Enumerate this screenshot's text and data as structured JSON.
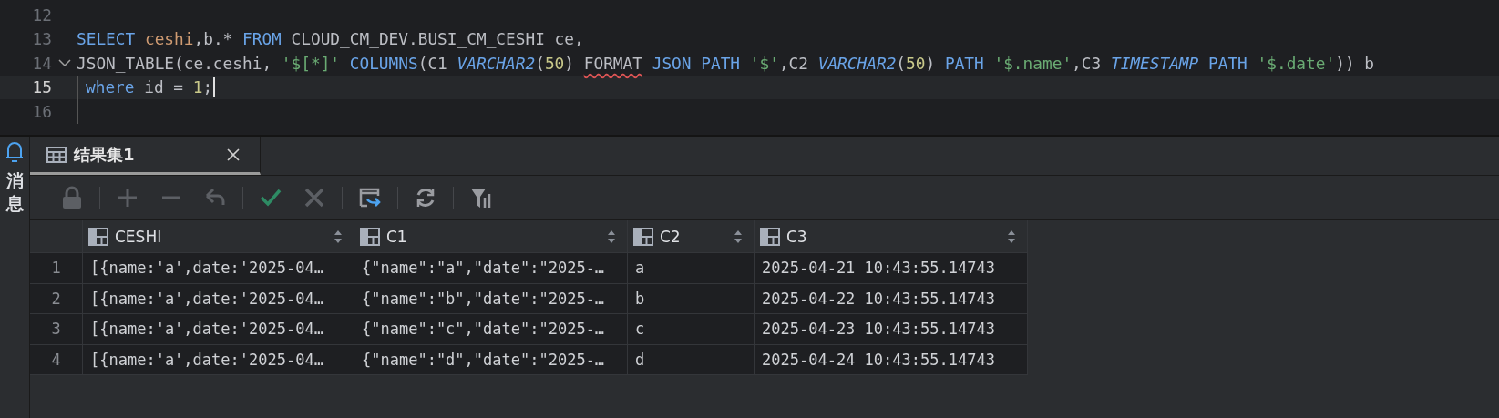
{
  "editor": {
    "lines": [
      {
        "number": "12",
        "current": false,
        "foldable": false,
        "indent_guide": false,
        "cursor": false
      },
      {
        "number": "13",
        "current": false,
        "foldable": false,
        "indent_guide": false,
        "cursor": false,
        "tokens": [
          {
            "kind": "keyword",
            "text": "SELECT "
          },
          {
            "kind": "ident",
            "text": "ceshi"
          },
          {
            "kind": "plain",
            "text": ",b.* "
          },
          {
            "kind": "keyword",
            "text": "FROM "
          },
          {
            "kind": "plain",
            "text": "CLOUD_CM_DEV.BUSI_CM_CESHI ce,"
          }
        ]
      },
      {
        "number": "14",
        "current": false,
        "foldable": true,
        "indent_guide": false,
        "cursor": false,
        "tokens": [
          {
            "kind": "plain",
            "text": "JSON_TABLE(ce.ceshi, "
          },
          {
            "kind": "string",
            "text": "'$[*]'"
          },
          {
            "kind": "keyword",
            "text": " COLUMNS"
          },
          {
            "kind": "plain",
            "text": "(C1 "
          },
          {
            "kind": "type",
            "text": "VARCHAR2"
          },
          {
            "kind": "plain",
            "text": "("
          },
          {
            "kind": "number",
            "text": "50"
          },
          {
            "kind": "plain",
            "text": ") "
          },
          {
            "kind": "error",
            "text": "FORMAT"
          },
          {
            "kind": "keyword",
            "text": " JSON PATH "
          },
          {
            "kind": "string",
            "text": "'$'"
          },
          {
            "kind": "plain",
            "text": ",C2 "
          },
          {
            "kind": "type",
            "text": "VARCHAR2"
          },
          {
            "kind": "plain",
            "text": "("
          },
          {
            "kind": "number",
            "text": "50"
          },
          {
            "kind": "plain",
            "text": ") "
          },
          {
            "kind": "keyword",
            "text": "PATH "
          },
          {
            "kind": "string",
            "text": "'$.name'"
          },
          {
            "kind": "plain",
            "text": ",C3 "
          },
          {
            "kind": "type",
            "text": "TIMESTAMP"
          },
          {
            "kind": "keyword",
            "text": " PATH "
          },
          {
            "kind": "string",
            "text": "'$.date'"
          },
          {
            "kind": "plain",
            "text": ")) b"
          }
        ]
      },
      {
        "number": "15",
        "current": true,
        "foldable": false,
        "indent_guide": true,
        "cursor": true,
        "tokens": [
          {
            "kind": "keyword",
            "text": "where "
          },
          {
            "kind": "plain",
            "text": "id = "
          },
          {
            "kind": "number",
            "text": "1"
          },
          {
            "kind": "plain",
            "text": ";"
          }
        ]
      },
      {
        "number": "16",
        "current": false,
        "foldable": false,
        "indent_guide": true,
        "cursor": false
      }
    ]
  },
  "sidebar": {
    "label": "消息"
  },
  "tabs": [
    {
      "label": "结果集1",
      "selected": true
    }
  ],
  "toolbar": [
    {
      "kind": "lock",
      "disabled": true
    },
    {
      "kind": "separator"
    },
    {
      "kind": "add",
      "disabled": true
    },
    {
      "kind": "remove",
      "disabled": true
    },
    {
      "kind": "undo",
      "disabled": true
    },
    {
      "kind": "separator"
    },
    {
      "kind": "commit",
      "disabled": false
    },
    {
      "kind": "cancel",
      "disabled": true
    },
    {
      "kind": "separator"
    },
    {
      "kind": "export",
      "disabled": false
    },
    {
      "kind": "separator"
    },
    {
      "kind": "refresh",
      "disabled": false
    },
    {
      "kind": "separator"
    },
    {
      "kind": "filter",
      "disabled": false
    }
  ],
  "table": {
    "columns": [
      "CESHI",
      "C1",
      "C2",
      "C3"
    ],
    "rows": [
      {
        "number": "1",
        "cells": [
          "[{name:'a',date:'2025-04…",
          "{\"name\":\"a\",\"date\":\"2025-…",
          "a",
          "2025-04-21 10:43:55.14743"
        ]
      },
      {
        "number": "2",
        "cells": [
          "[{name:'a',date:'2025-04…",
          "{\"name\":\"b\",\"date\":\"2025-…",
          "b",
          "2025-04-22 10:43:55.14743"
        ]
      },
      {
        "number": "3",
        "cells": [
          "[{name:'a',date:'2025-04…",
          "{\"name\":\"c\",\"date\":\"2025-…",
          "c",
          "2025-04-23 10:43:55.14743"
        ]
      },
      {
        "number": "4",
        "cells": [
          "[{name:'a',date:'2025-04…",
          "{\"name\":\"d\",\"date\":\"2025-…",
          "d",
          "2025-04-24 10:43:55.14743"
        ]
      }
    ]
  }
}
